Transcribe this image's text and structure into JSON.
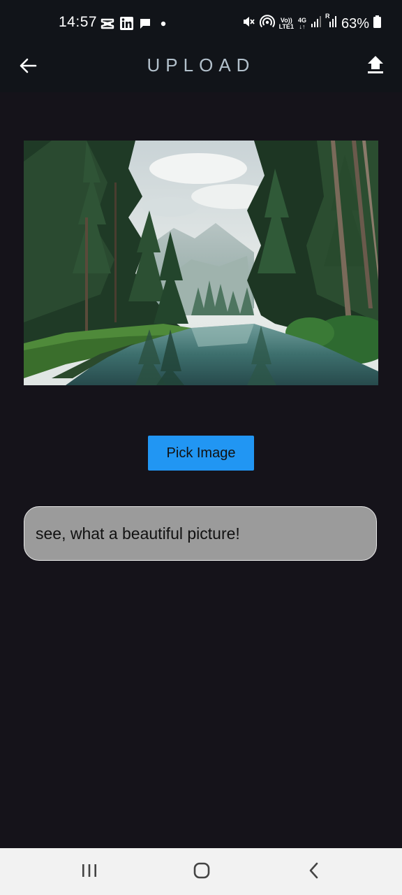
{
  "status_bar": {
    "time": "14:57",
    "battery_percent": "63%",
    "network_label_top": "Vo))",
    "network_label_bottom": "LTE1",
    "network_gen": "4G",
    "sim2_label": "R",
    "icons": [
      "capcut-icon",
      "linkedin-icon",
      "message-icon",
      "dot-icon",
      "mute-icon",
      "hotspot-icon",
      "signal-icon",
      "signal-icon-2",
      "battery-icon"
    ]
  },
  "app_bar": {
    "title": "UPLOAD",
    "back_icon": "arrow-left-icon",
    "action_icon": "upload-icon"
  },
  "preview": {
    "image": "forest-lake-photo"
  },
  "actions": {
    "pick_label": "Pick Image"
  },
  "caption": {
    "value": "see, what a beautiful picture!"
  },
  "nav_bar": {
    "icons": [
      "recent-apps-icon",
      "home-icon",
      "back-icon"
    ]
  },
  "colors": {
    "background": "#15131a",
    "bar": "#111419",
    "accent": "#2196f3",
    "title": "#b3c1cc",
    "field": "#9b9b9b"
  }
}
